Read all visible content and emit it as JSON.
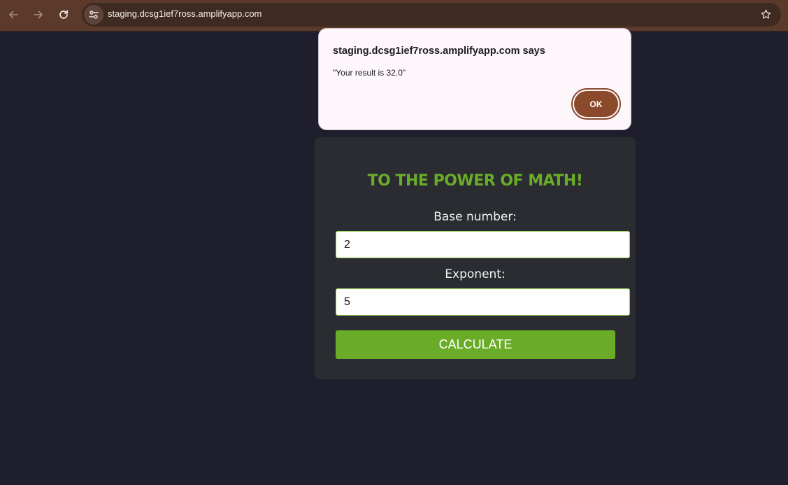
{
  "browser": {
    "url": "staging.dcsg1ief7ross.amplifyapp.com",
    "toolbar_color": "#5b3a2b",
    "icons": {
      "back": "arrow-left-icon",
      "forward": "arrow-right-icon",
      "reload": "reload-icon",
      "site_info": "tune-icon",
      "bookmark": "star-icon"
    }
  },
  "dialog": {
    "title": "staging.dcsg1ief7ross.amplifyapp.com says",
    "message": "\"Your result is 32.0\"",
    "ok_label": "OK",
    "accent_color": "#8b4a2b"
  },
  "app": {
    "title": "TO THE POWER OF MATH!",
    "base_label": "Base number:",
    "base_value": "2",
    "exponent_label": "Exponent:",
    "exponent_value": "5",
    "calculate_label": "CALCULATE",
    "accent_color": "#6aac27"
  }
}
